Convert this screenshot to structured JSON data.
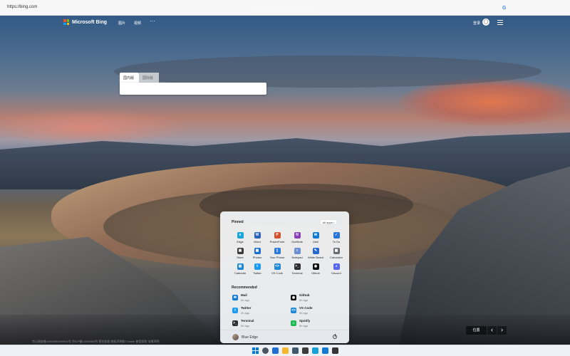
{
  "browser": {
    "url": "https://bing.com",
    "g_icon": "G"
  },
  "header": {
    "brand": "Microsoft Bing",
    "links": [
      "图片",
      "视频"
    ],
    "more": "···",
    "signin": "登录"
  },
  "search": {
    "tabs": [
      "国内版",
      "国际版"
    ],
    "value": ""
  },
  "start_menu": {
    "pinned_title": "Pinned",
    "all_apps": "All apps  ›",
    "apps": [
      {
        "label": "Edge",
        "icon": "edge-icon",
        "color": "#18a6d9",
        "glyph": "e"
      },
      {
        "label": "Word",
        "icon": "word-icon",
        "color": "#2b63b8",
        "glyph": "W"
      },
      {
        "label": "PowerPoint",
        "icon": "powerpoint-icon",
        "color": "#d35230",
        "glyph": "P"
      },
      {
        "label": "OneNote",
        "icon": "onenote-icon",
        "color": "#8a3eb8",
        "glyph": "N"
      },
      {
        "label": "Mail",
        "icon": "mail-icon",
        "color": "#1279d0",
        "glyph": "✉"
      },
      {
        "label": "To Do",
        "icon": "todo-icon",
        "color": "#2a75d7",
        "glyph": "✓"
      },
      {
        "label": "Store",
        "icon": "store-icon",
        "color": "#3b3b3b",
        "glyph": "▣"
      },
      {
        "label": "Photos",
        "icon": "photos-icon",
        "color": "#1c6fcf",
        "glyph": "▦"
      },
      {
        "label": "Your Phone",
        "icon": "phone-icon",
        "color": "#2b7bd8",
        "glyph": "▯"
      },
      {
        "label": "Notepad",
        "icon": "notepad-icon",
        "color": "#6a8fd2",
        "glyph": "≡"
      },
      {
        "label": "White Board",
        "icon": "whiteboard-icon",
        "color": "#2369ce",
        "glyph": "✎"
      },
      {
        "label": "Calculator",
        "icon": "calculator-icon",
        "color": "#676d74",
        "glyph": "▦"
      },
      {
        "label": "Calendar",
        "icon": "calendar-icon",
        "color": "#1d86d3",
        "glyph": "▤"
      },
      {
        "label": "Twitter",
        "icon": "twitter-icon",
        "color": "#1d9bf0",
        "glyph": "t"
      },
      {
        "label": "VS Code",
        "icon": "vscode-icon",
        "color": "#1e8ad6",
        "glyph": "<>"
      },
      {
        "label": "Terminal",
        "icon": "terminal-icon",
        "color": "#2d2d2d",
        "glyph": ">_"
      },
      {
        "label": "Github",
        "icon": "github-icon",
        "color": "#111111",
        "glyph": "◉"
      },
      {
        "label": "Discord",
        "icon": "discord-icon",
        "color": "#5865f2",
        "glyph": "◕"
      }
    ],
    "recommended_title": "Recommended",
    "recommended": [
      {
        "title": "Mail",
        "time": "5h ago",
        "icon": "mail-icon",
        "color": "#1279d0",
        "glyph": "✉"
      },
      {
        "title": "Github",
        "time": "5h ago",
        "icon": "github-icon",
        "color": "#111111",
        "glyph": "◉"
      },
      {
        "title": "Twitter",
        "time": "2h ago",
        "icon": "twitter-icon",
        "color": "#1d9bf0",
        "glyph": "t"
      },
      {
        "title": "VS Code",
        "time": "4h ago",
        "icon": "vscode-icon",
        "color": "#1e8ad6",
        "glyph": "<>"
      },
      {
        "title": "Terminal",
        "time": "5h ago",
        "icon": "terminal-icon",
        "color": "#2d2d2d",
        "glyph": ">_"
      },
      {
        "title": "Spotify",
        "time": "5h ago",
        "icon": "spotify-icon",
        "color": "#1db954",
        "glyph": "♫"
      }
    ],
    "user_name": "Blue Edge"
  },
  "footer": {
    "location": "位置",
    "prev": "‹",
    "next": "›",
    "links": "京公网安备11000002000001号   京ICP备10036305号   营业执照   隐私声明和 Cookie   使用条款   法律声明"
  },
  "taskbar": {
    "icons": [
      {
        "icon": "search-icon",
        "color": "#4b5563"
      },
      {
        "icon": "widgets-icon",
        "color": "#1e6fd1"
      },
      {
        "icon": "folder-icon",
        "color": "#f5b72f"
      },
      {
        "icon": "settings-icon",
        "color": "#41586f"
      },
      {
        "icon": "store-icon",
        "color": "#3c3c3c"
      },
      {
        "icon": "edge-icon",
        "color": "#16a0d8"
      },
      {
        "icon": "mail-icon",
        "color": "#1279d0"
      },
      {
        "icon": "file-icon",
        "color": "#343434"
      }
    ]
  }
}
